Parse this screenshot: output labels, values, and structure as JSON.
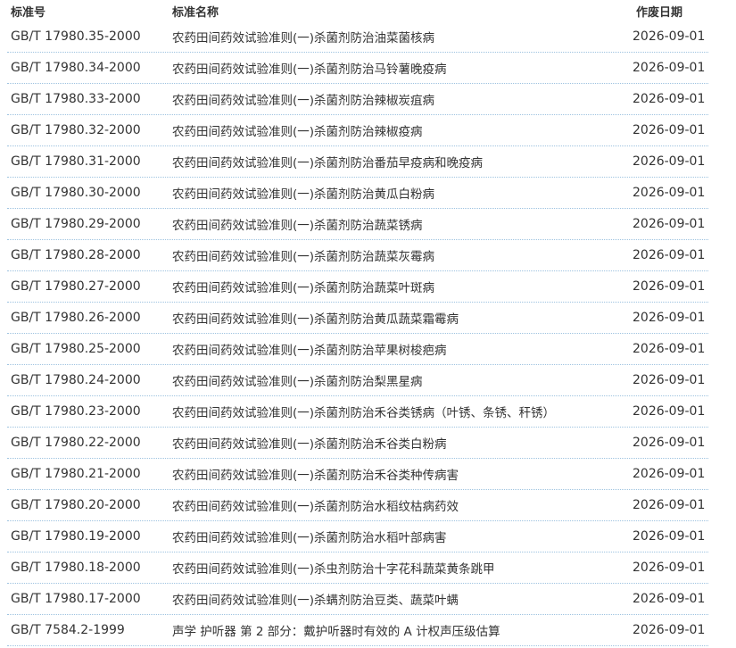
{
  "table": {
    "headers": {
      "code": "标准号",
      "name": "标准名称",
      "date": "作废日期"
    },
    "rows": [
      {
        "code": "GB/T 17980.35-2000",
        "name": "农药田间药效试验准则(一)杀菌剂防治油菜菌核病",
        "date": "2026-09-01"
      },
      {
        "code": "GB/T 17980.34-2000",
        "name": "农药田间药效试验准则(一)杀菌剂防治马铃薯晚疫病",
        "date": "2026-09-01"
      },
      {
        "code": "GB/T 17980.33-2000",
        "name": "农药田间药效试验准则(一)杀菌剂防治辣椒炭疽病",
        "date": "2026-09-01"
      },
      {
        "code": "GB/T 17980.32-2000",
        "name": "农药田间药效试验准则(一)杀菌剂防治辣椒疫病",
        "date": "2026-09-01"
      },
      {
        "code": "GB/T 17980.31-2000",
        "name": "农药田间药效试验准则(一)杀菌剂防治番茄早疫病和晚疫病",
        "date": "2026-09-01"
      },
      {
        "code": "GB/T 17980.30-2000",
        "name": "农药田间药效试验准则(一)杀菌剂防治黄瓜白粉病",
        "date": "2026-09-01"
      },
      {
        "code": "GB/T 17980.29-2000",
        "name": "农药田间药效试验准则(一)杀菌剂防治蔬菜锈病",
        "date": "2026-09-01"
      },
      {
        "code": "GB/T 17980.28-2000",
        "name": "农药田间药效试验准则(一)杀菌剂防治蔬菜灰霉病",
        "date": "2026-09-01"
      },
      {
        "code": "GB/T 17980.27-2000",
        "name": "农药田间药效试验准则(一)杀菌剂防治蔬菜叶斑病",
        "date": "2026-09-01"
      },
      {
        "code": "GB/T 17980.26-2000",
        "name": "农药田间药效试验准则(一)杀菌剂防治黄瓜蔬菜霜霉病",
        "date": "2026-09-01"
      },
      {
        "code": "GB/T 17980.25-2000",
        "name": "农药田间药效试验准则(一)杀菌剂防治苹果树梭疤病",
        "date": "2026-09-01"
      },
      {
        "code": "GB/T 17980.24-2000",
        "name": "农药田间药效试验准则(一)杀菌剂防治梨黑星病",
        "date": "2026-09-01"
      },
      {
        "code": "GB/T 17980.23-2000",
        "name": "农药田间药效试验准则(一)杀菌剂防治禾谷类锈病（叶锈、条锈、秆锈）",
        "date": "2026-09-01"
      },
      {
        "code": "GB/T 17980.22-2000",
        "name": "农药田间药效试验准则(一)杀菌剂防治禾谷类白粉病",
        "date": "2026-09-01"
      },
      {
        "code": "GB/T 17980.21-2000",
        "name": "农药田间药效试验准则(一)杀菌剂防治禾谷类种传病害",
        "date": "2026-09-01"
      },
      {
        "code": "GB/T 17980.20-2000",
        "name": "农药田间药效试验准则(一)杀菌剂防治水稻纹枯病药效",
        "date": "2026-09-01"
      },
      {
        "code": "GB/T 17980.19-2000",
        "name": "农药田间药效试验准则(一)杀菌剂防治水稻叶部病害",
        "date": "2026-09-01"
      },
      {
        "code": "GB/T 17980.18-2000",
        "name": "农药田间药效试验准则(一)杀虫剂防治十字花科蔬菜黄条跳甲",
        "date": "2026-09-01"
      },
      {
        "code": "GB/T 17980.17-2000",
        "name": "农药田间药效试验准则(一)杀螨剂防治豆类、蔬菜叶螨",
        "date": "2026-09-01"
      },
      {
        "code": "GB/T 7584.2-1999",
        "name": "声学 护听器 第 2 部分：戴护听器时有效的 A 计权声压级估算",
        "date": "2026-09-01"
      }
    ]
  }
}
